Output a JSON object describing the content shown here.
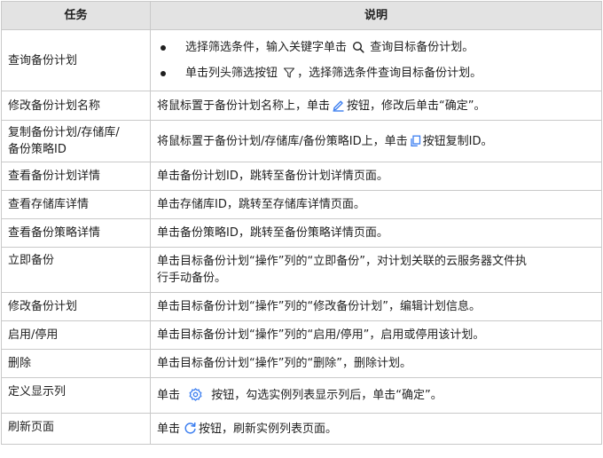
{
  "header": {
    "task": "任务",
    "desc": "说明"
  },
  "colors": {
    "header_bg": "#e3e3e3",
    "border": "#c9c9c9",
    "icon_blue": "#3d7ff0"
  },
  "rows": {
    "query": {
      "task": "查询备份计划",
      "b1_pre": "选择筛选条件，输入关键字单击",
      "b1_icon": "search-icon",
      "b1_post": "查询目标备份计划。",
      "b2_pre": "单击列头筛选按钮",
      "b2_icon": "filter-icon",
      "b2_post": "，选择筛选条件查询目标备份计划。"
    },
    "rename": {
      "task": "修改备份计划名称",
      "pre": "将鼠标置于备份计划名称上，单击",
      "icon": "edit-icon",
      "post": "按钮，修改后单击“确定”。"
    },
    "copy": {
      "task_line1": "复制备份计划/存储库/",
      "task_line2": "备份策略ID",
      "pre": "将鼠标置于备份计划/存储库/备份策略ID上，单击",
      "icon": "copy-icon",
      "post": "按钮复制ID。"
    },
    "plan_detail": {
      "task": "查看备份计划详情",
      "desc": "单击备份计划ID，跳转至备份计划详情页面。"
    },
    "vault_detail": {
      "task": "查看存储库详情",
      "desc": "单击存储库ID，跳转至存储库详情页面。"
    },
    "policy_detail": {
      "task": "查看备份策略详情",
      "desc": "单击备份策略ID，跳转至备份策略详情页面。"
    },
    "backup_now": {
      "task": "立即备份",
      "desc_line1": "单击目标备份计划“操作”列的“立即备份”，对计划关联的云服务器文件执",
      "desc_line2": "行手动备份。"
    },
    "edit_plan": {
      "task": "修改备份计划",
      "desc": "单击目标备份计划“操作”列的“修改备份计划”，编辑计划信息。"
    },
    "toggle": {
      "task": "启用/停用",
      "desc": "单击目标备份计划“操作”列的“启用/停用”，启用或停用该计划。"
    },
    "delete": {
      "task": "删除",
      "desc": "单击目标备份计划“操作”列的“删除”，删除计划。"
    },
    "columns": {
      "task": "定义显示列",
      "pre": "单击",
      "icon": "gear-icon",
      "post": "按钮，勾选实例列表显示列后，单击“确定”。"
    },
    "refresh": {
      "task": "刷新页面",
      "pre": "单击",
      "icon": "refresh-icon",
      "post": "按钮，刷新实例列表页面。"
    }
  }
}
